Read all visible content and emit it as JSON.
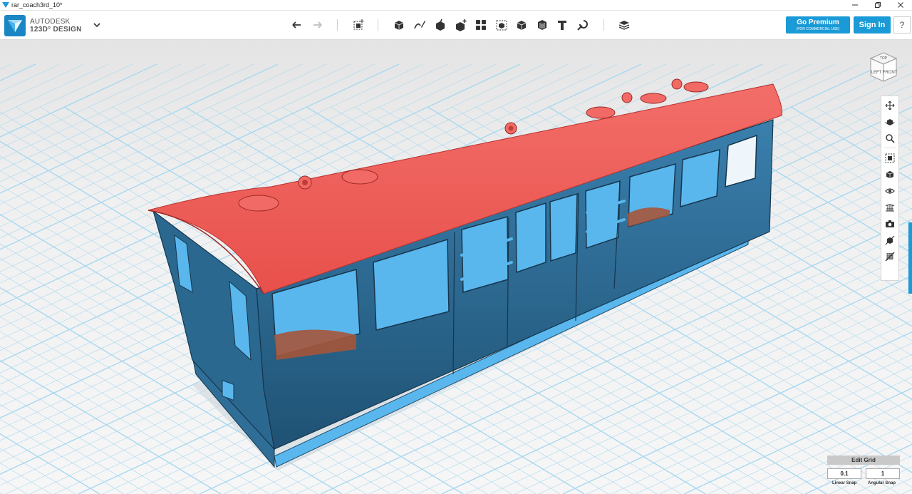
{
  "window": {
    "title": "rar_coach3rd_10*"
  },
  "brand": {
    "line1": "AUTODESK",
    "line2": "123D° DESIGN"
  },
  "toolbar": {
    "undo_icon": "undo-icon",
    "redo_icon": "redo-icon",
    "tools": [
      "transform",
      "primitives",
      "sketch",
      "construct",
      "modify",
      "pattern",
      "group",
      "combine",
      "measure",
      "text",
      "snap",
      "material"
    ]
  },
  "account": {
    "premium_label": "Go Premium",
    "premium_sub": "(FOR COMMERCIAL USE)",
    "signin_label": "Sign In",
    "help_label": "?"
  },
  "viewcube": {
    "top": "TOP",
    "left": "LEFT",
    "front": "FRONT"
  },
  "grid": {
    "edit_label": "Edit Grid",
    "linear_snap_value": "0.1",
    "linear_snap_label": "Linear Snap",
    "angular_snap_value": "1",
    "angular_snap_label": "Angular Snap"
  },
  "colors": {
    "accent": "#1a9ad6",
    "roof": "#f05a55",
    "body": "#2e6e97",
    "interior": "#59b7ee",
    "grid_line": "#a8d8f0",
    "background": "#ececec"
  }
}
